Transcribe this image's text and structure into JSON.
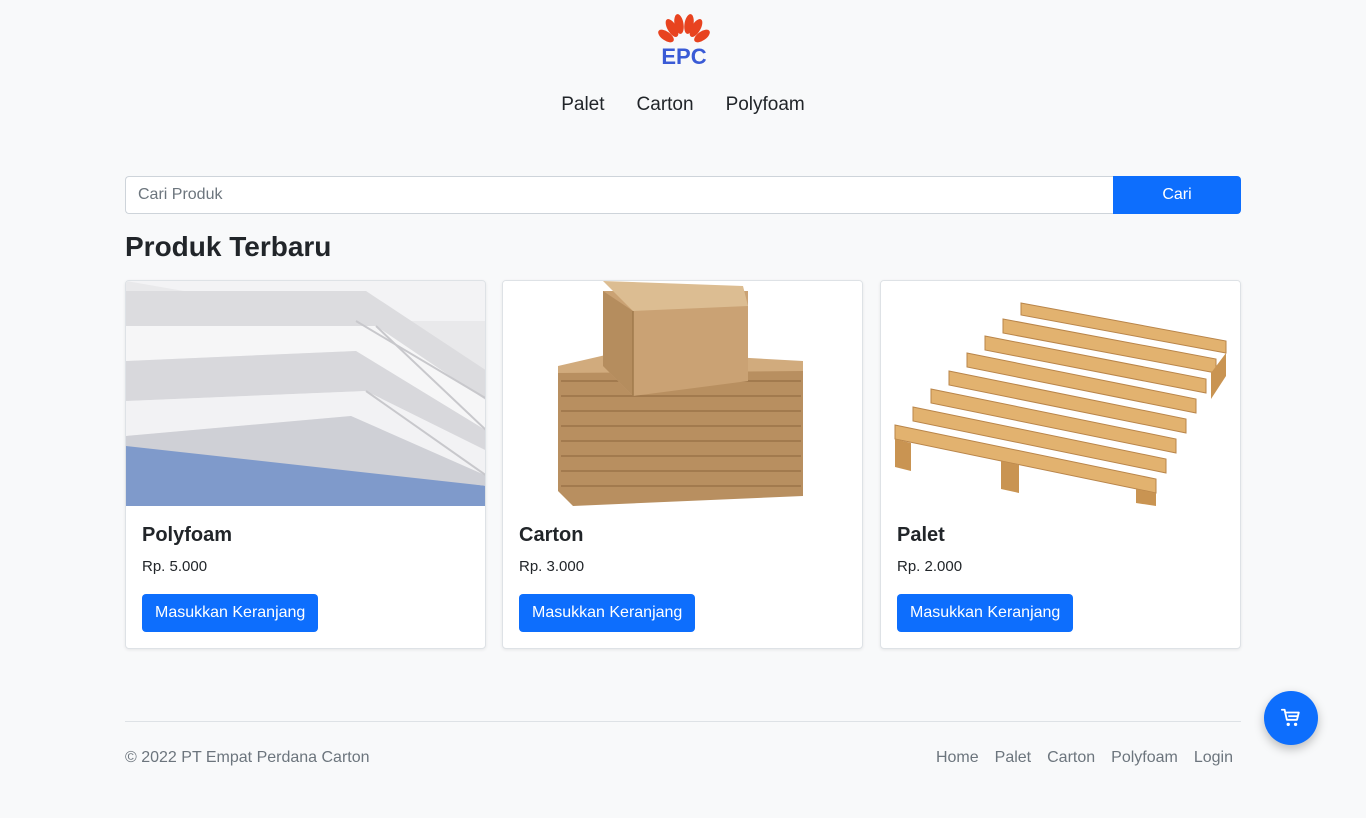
{
  "brand": {
    "logo_text": "EPC",
    "primary_color": "#0d6efd",
    "logo_petal_color": "#e8431f"
  },
  "topnav": {
    "items": [
      "Palet",
      "Carton",
      "Polyfoam"
    ]
  },
  "search": {
    "placeholder": "Cari Produk",
    "value": "",
    "button_label": "Cari"
  },
  "section": {
    "title": "Produk Terbaru"
  },
  "products": [
    {
      "name": "Polyfoam",
      "price": "Rp. 5.000",
      "button_label": "Masukkan Keranjang",
      "image": "polyfoam-sheets"
    },
    {
      "name": "Carton",
      "price": "Rp. 3.000",
      "button_label": "Masukkan Keranjang",
      "image": "carton-boxes"
    },
    {
      "name": "Palet",
      "price": "Rp. 2.000",
      "button_label": "Masukkan Keranjang",
      "image": "wooden-pallet"
    }
  ],
  "footer": {
    "copyright": "© 2022 PT Empat Perdana Carton",
    "links": [
      "Home",
      "Palet",
      "Carton",
      "Polyfoam",
      "Login"
    ]
  },
  "cart_fab": {
    "icon": "cart-icon"
  }
}
